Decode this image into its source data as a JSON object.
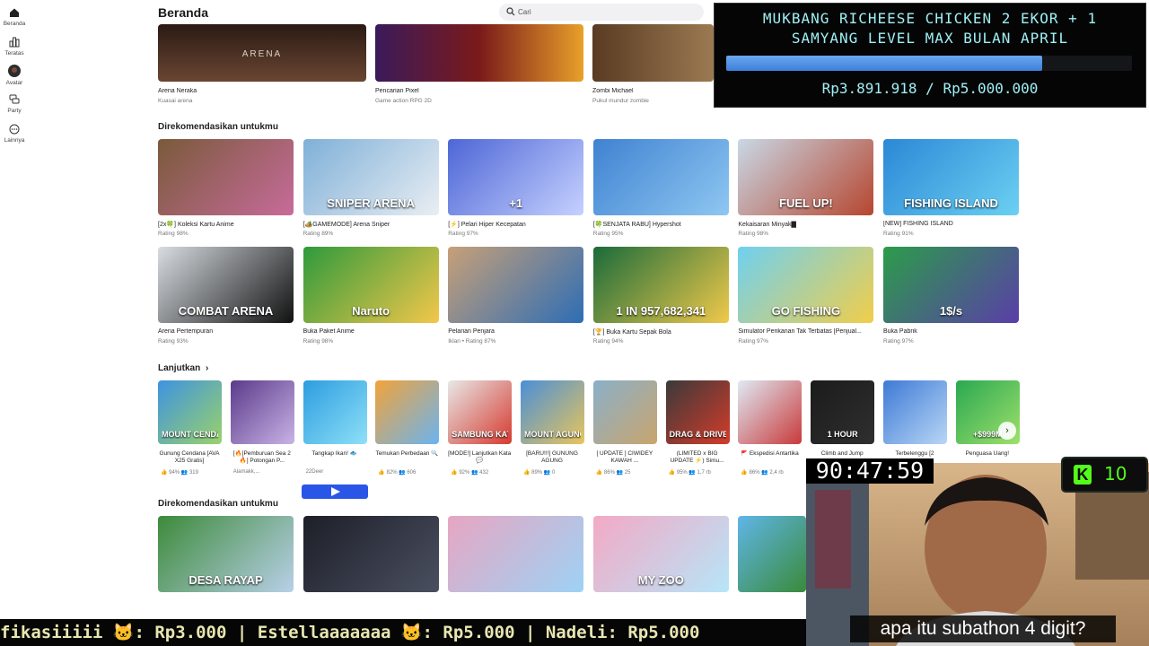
{
  "sidebar": [
    {
      "label": "Beranda",
      "icon": "home-icon"
    },
    {
      "label": "Teratas",
      "icon": "charts-icon"
    },
    {
      "label": "Avatar",
      "icon": "avatar-icon"
    },
    {
      "label": "Party",
      "icon": "party-icon"
    },
    {
      "label": "Lainnya",
      "icon": "more-icon"
    }
  ],
  "header": {
    "title": "Beranda",
    "search_placeholder": "Cari"
  },
  "top_row": [
    {
      "title": "Arena Neraka",
      "sub": "Kuasai arena",
      "art": "ARENA"
    },
    {
      "title": "Pencarian Pixel",
      "sub": "Game action RPG 2D",
      "art": ""
    },
    {
      "title": "Zombi Michael",
      "sub": "Pukul mundur zombie",
      "art": ""
    }
  ],
  "sections": {
    "rec1": "Direkomendasikan untukmu",
    "continue": "Lanjutkan",
    "rec2": "Direkomendasikan untukmu"
  },
  "rec_row1": [
    {
      "title": "[2x🍀] Koleksi Kartu Anime",
      "rating": "Rating 98%",
      "art": "",
      "c1": "#7a5a3a",
      "c2": "#c76b9a"
    },
    {
      "title": "[🏕️GAMEMODE] Arena Sniper",
      "rating": "Rating 89%",
      "art": "SNIPER ARENA",
      "c1": "#7fb0d8",
      "c2": "#e9eef3"
    },
    {
      "title": "[⚡] Pelari Hiper Kecepatan",
      "rating": "Rating 97%",
      "art": "+1",
      "c1": "#4d66d6",
      "c2": "#c6d1ff"
    },
    {
      "title": "[🍀SENJATA RABU] Hypershot",
      "rating": "Rating 95%",
      "art": "",
      "c1": "#3f82d1",
      "c2": "#8fc7f2"
    },
    {
      "title": "Kekaisaran Minyak▇",
      "rating": "Rating 98%",
      "art": "FUEL UP!",
      "c1": "#c9d8e6",
      "c2": "#b6462f"
    },
    {
      "title": "[NEW] FISHING ISLAND",
      "rating": "Rating 91%",
      "art": "FISHING ISLAND",
      "c1": "#2b88d6",
      "c2": "#6bd0f2"
    }
  ],
  "rec_row2": [
    {
      "title": "Arena Pertempuran",
      "rating": "Rating 93%",
      "art": "COMBAT ARENA",
      "c1": "#d8dde2",
      "c2": "#111111"
    },
    {
      "title": "Buka Paket Anime",
      "rating": "Rating 98%",
      "art": "Naruto",
      "c1": "#2e9a3c",
      "c2": "#f3c74a"
    },
    {
      "title": "Pelarian Penjara",
      "rating": "Iklan • Rating 87%",
      "art": "",
      "c1": "#c7a078",
      "c2": "#2e6db5"
    },
    {
      "title": "[🏆] Buka Kartu Sepak Bola",
      "rating": "Rating 94%",
      "art": "1 IN 957,682,341",
      "c1": "#1a6b3a",
      "c2": "#f0c94b"
    },
    {
      "title": "Simulator Perikanan Tak Terbatas [Penjual...",
      "rating": "Rating 97%",
      "art": "GO FISHING",
      "c1": "#6fd0f0",
      "c2": "#f1ce4a"
    },
    {
      "title": "Buka Pabrik",
      "rating": "Rating 97%",
      "art": "1$/s",
      "c1": "#2c9c4a",
      "c2": "#5a3ea8"
    }
  ],
  "continue_row": [
    {
      "title": "Gunung Cendana [AVA X25 Gratis]",
      "stats": "👍 94%  👥 319",
      "art": "MOUNT CENDANA",
      "c1": "#3e93e0",
      "c2": "#9ad26a"
    },
    {
      "title": "[🔥]Pemburuan Sea 2🔥] Potongan P...",
      "stats": "Alamakk,...",
      "art": "",
      "c1": "#5b3a8a",
      "c2": "#c8b3e6"
    },
    {
      "title": "Tangkap Ikan! 🐟",
      "stats": "22Deer",
      "art": "",
      "c1": "#2d9de0",
      "c2": "#8ee0f7"
    },
    {
      "title": "Temukan Perbedaan 🔍",
      "stats": "👍 82%  👥 606",
      "art": "",
      "c1": "#f2a33a",
      "c2": "#6ab4f0"
    },
    {
      "title": "[MODE!] Lanjutkan Kata 💬",
      "stats": "👍 92%  👥 432",
      "art": "SAMBUNG KATA",
      "c1": "#e8e8e8",
      "c2": "#d63a2f"
    },
    {
      "title": "[BARU!!!] GUNUNG AGUNG",
      "stats": "👍 89%  👥 0",
      "art": "MOUNT AGUNG",
      "c1": "#4a8fd8",
      "c2": "#e8c55a"
    },
    {
      "title": "[ UPDATE ] CIWIDEY KAWAH ...",
      "stats": "👍 86%  👥 25",
      "art": "",
      "c1": "#8ab0c9",
      "c2": "#c9a56e"
    },
    {
      "title": "(LIMITED x BIG UPDATE ⚡) Simu...",
      "stats": "👍 95%  👥 1,7 rb",
      "art": "DRAG & DRIVE",
      "c1": "#3a3a3a",
      "c2": "#d43b2a"
    },
    {
      "title": "🚩 Ekspedisi Antartika",
      "stats": "👍 86%  👥 2,4 rb",
      "art": "",
      "c1": "#dfeaf5",
      "c2": "#c83a3a"
    },
    {
      "title": "Climb and Jump",
      "stats": "",
      "art": "1 HOUR",
      "c1": "#1b1b1b",
      "c2": "#2f2f2f"
    },
    {
      "title": "Terbelenggu [2",
      "stats": "",
      "art": "",
      "c1": "#3e7ad6",
      "c2": "#b8d6f5"
    },
    {
      "title": "Penguasa Uang!",
      "stats": "",
      "art": "+$999M",
      "c1": "#2aa852",
      "c2": "#9ee06a"
    }
  ],
  "rec_row3": [
    {
      "art": "DESA RAYAP",
      "c1": "#3d8a3a",
      "c2": "#b8d0e8"
    },
    {
      "art": "",
      "c1": "#1d1f28",
      "c2": "#4a4f60"
    },
    {
      "art": "",
      "c1": "#e7a6c2",
      "c2": "#9ed2f5"
    },
    {
      "art": "MY ZOO",
      "c1": "#f4a9c5",
      "c2": "#b7e5f8"
    },
    {
      "art": "",
      "c1": "#5fb6e8",
      "c2": "#3a8a3a"
    }
  ],
  "donation": {
    "title_line1": "MUKBANG RICHEESE CHICKEN 2 EKOR + 1",
    "title_line2": "SAMYANG LEVEL MAX BULAN APRIL",
    "amount_text": "Rp3.891.918 / Rp5.000.000",
    "progress": 0.778
  },
  "stream": {
    "timer": "90:47:59",
    "kick_count": "10",
    "ticker": "fikasiiiii 🐱: Rp3.000 | Estellaaaaaaa 🐱: Rp5.000 | Nadeli: Rp5.000",
    "subtitle": "apa itu subathon 4 digit?"
  },
  "colors": {
    "accent": "#2a56e8",
    "kick": "#53fc18",
    "donation_text": "#9ff0f5"
  }
}
